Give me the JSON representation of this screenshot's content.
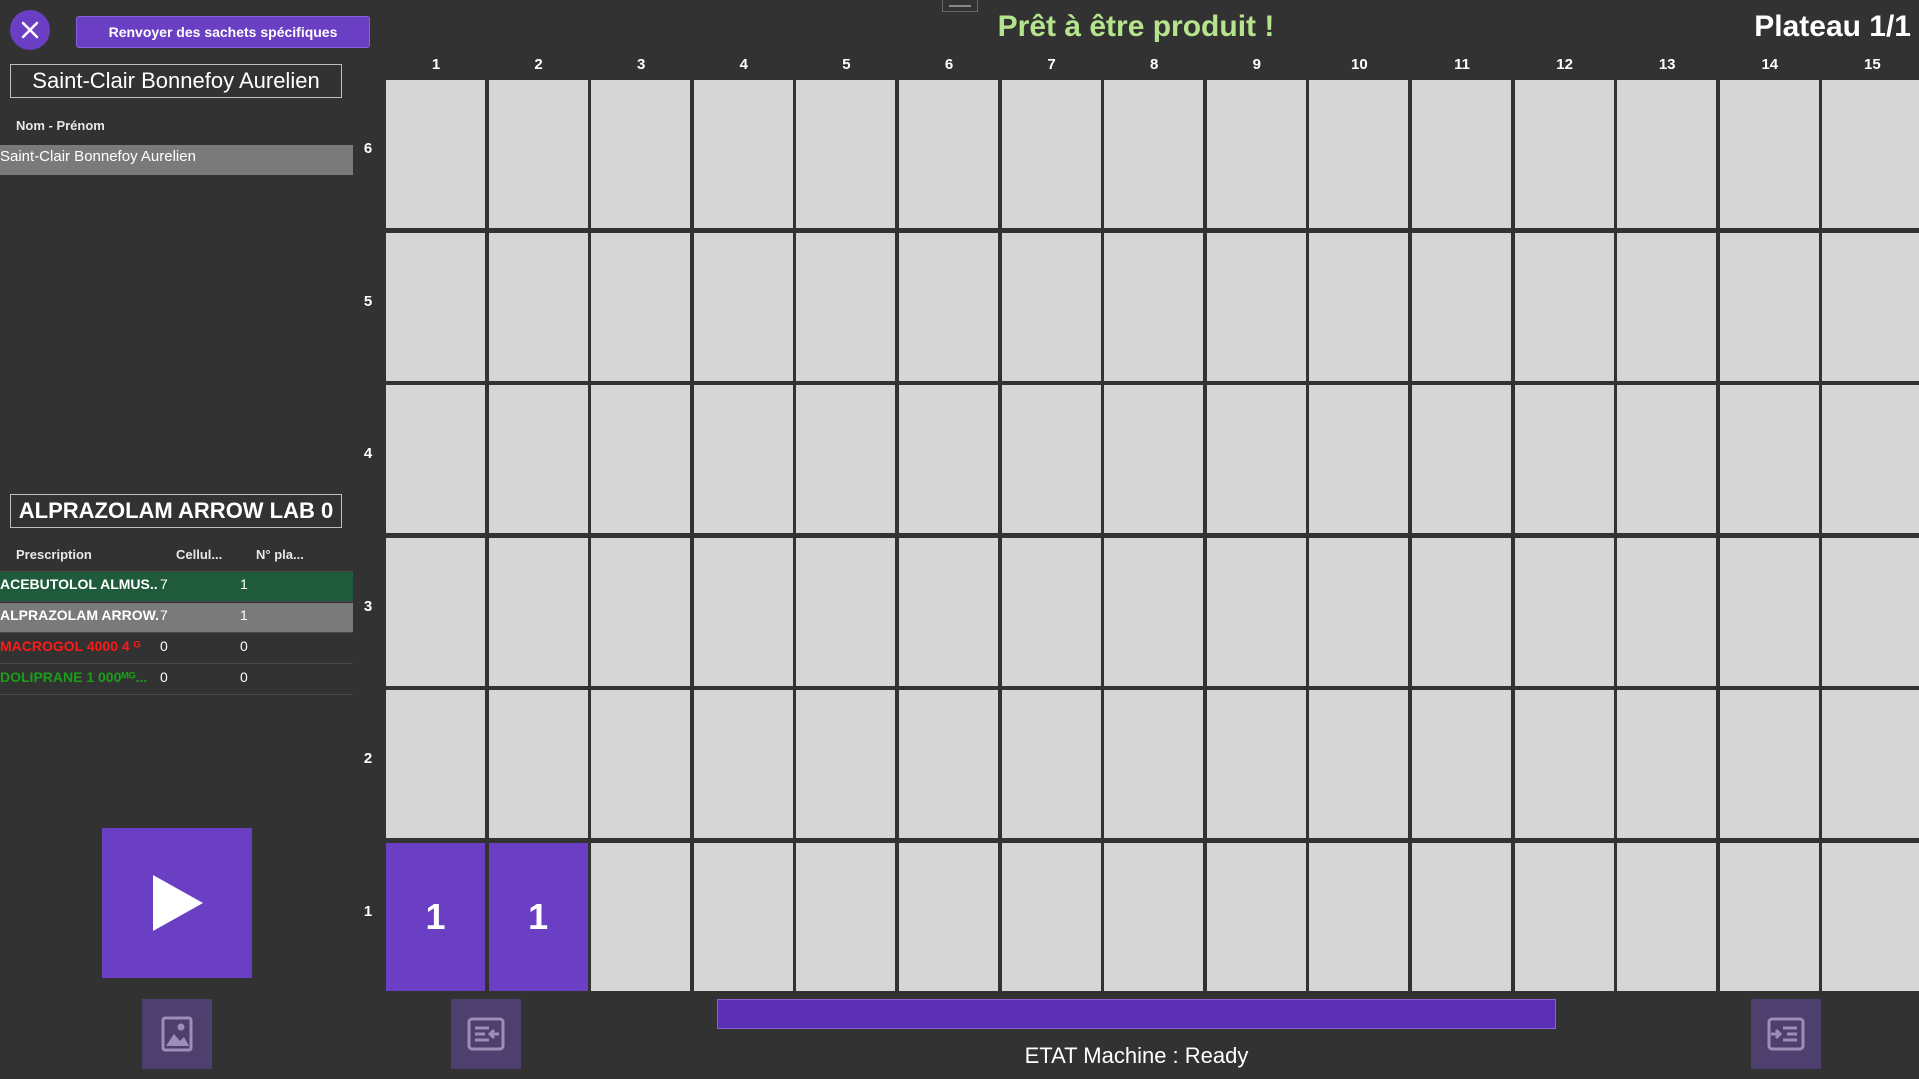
{
  "header": {
    "close_icon": "close-icon",
    "resend_label": "Renvoyer des sachets spécifiques",
    "status_title": "Prêt à être produit !",
    "plateau": "Plateau 1/1"
  },
  "patient": {
    "selected_name": "Saint-Clair Bonnefoy Aurelien",
    "column_label": "Nom - Prénom",
    "rows": [
      "Saint-Clair Bonnefoy Aurelien"
    ]
  },
  "drug": {
    "selected_name": "ALPRAZOLAM ARROW LAB 0"
  },
  "prescriptions": {
    "headers": [
      "Prescription",
      "Cellul...",
      "N° pla..."
    ],
    "rows": [
      {
        "name": "ACEBUTOLOL ALMUS...",
        "cell": "7",
        "plate": "1",
        "color": "#ffffff",
        "bg": "#1f5b3a"
      },
      {
        "name": "ALPRAZOLAM ARROW...",
        "cell": "7",
        "plate": "1",
        "color": "#ffffff",
        "bg": "#7a7a7a"
      },
      {
        "name": "MACROGOL 4000 4 ᴳ",
        "cell": "0",
        "plate": "0",
        "color": "#ff1a1a",
        "bg": "transparent"
      },
      {
        "name": "DOLIPRANE 1 000ᴹᴳ...",
        "cell": "0",
        "plate": "0",
        "color": "#1a9e1a",
        "bg": "transparent"
      }
    ]
  },
  "grid": {
    "columns": [
      "1",
      "2",
      "3",
      "4",
      "5",
      "6",
      "7",
      "8",
      "9",
      "10",
      "11",
      "12",
      "13",
      "14",
      "15"
    ],
    "rows": [
      "6",
      "5",
      "4",
      "3",
      "2",
      "1"
    ],
    "filled": [
      {
        "row": "1",
        "col": "1",
        "label": "1"
      },
      {
        "row": "1",
        "col": "2",
        "label": "1"
      }
    ],
    "accent_color": "#6a3fc4",
    "empty_color": "#d6d6d6"
  },
  "footer": {
    "play_icon": "play-icon",
    "image_icon": "image-icon",
    "exit_left_icon": "panel-arrow-left-icon",
    "exit_right_icon": "panel-arrow-right-icon",
    "progress": 1.0,
    "machine_state": "ETAT Machine : Ready"
  }
}
